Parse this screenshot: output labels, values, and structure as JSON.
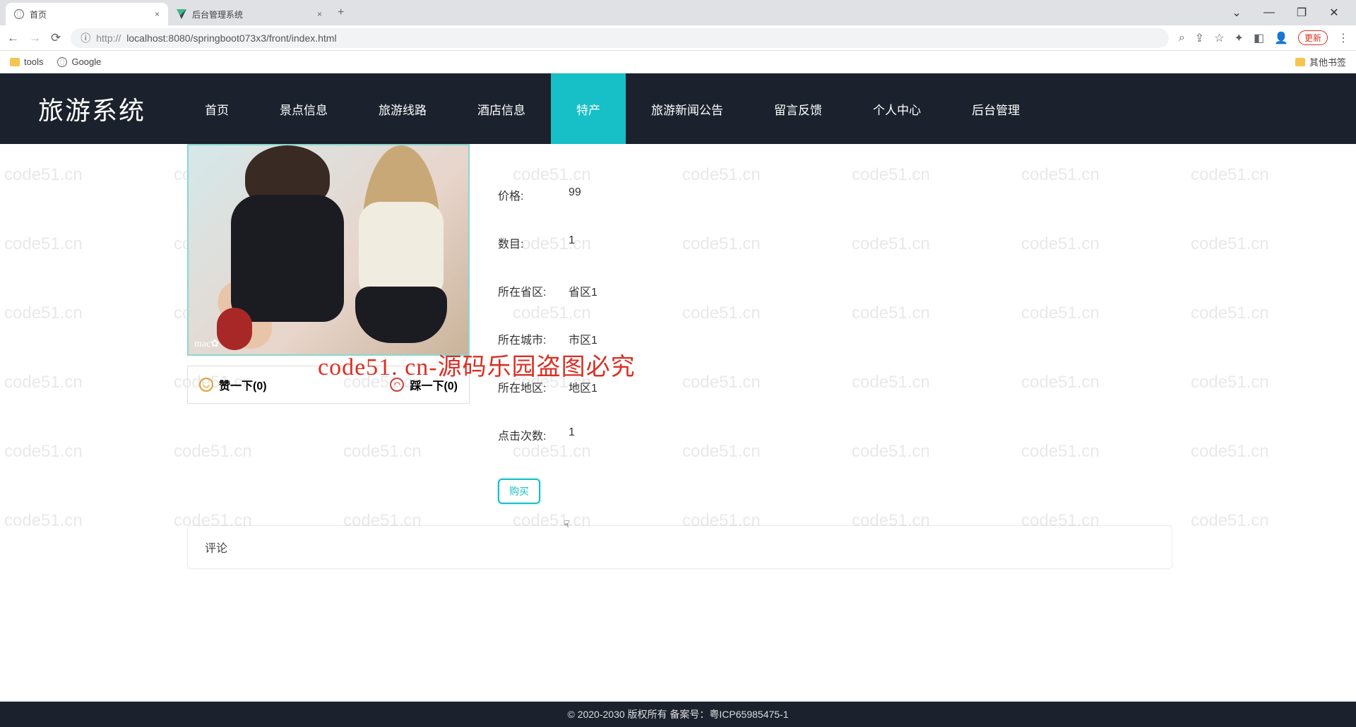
{
  "browser": {
    "tabs": [
      {
        "title": "首页",
        "icon": "globe"
      },
      {
        "title": "后台管理系统",
        "icon": "vue"
      }
    ],
    "url_scheme": "http://",
    "url_rest": "localhost:8080/springboot073x3/front/index.html",
    "update_label": "更新",
    "bookmarks": {
      "tools": "tools",
      "google": "Google",
      "other": "其他书签"
    }
  },
  "site": {
    "logo": "旅游系统",
    "nav": [
      "首页",
      "景点信息",
      "旅游线路",
      "酒店信息",
      "特产",
      "旅游新闻公告",
      "留言反馈",
      "个人中心",
      "后台管理"
    ],
    "active_index": 4
  },
  "product": {
    "image_tag": "mac✿",
    "like_label": "赞一下(0)",
    "dislike_label": "踩一下(0)",
    "rows": [
      {
        "label": "价格:",
        "value": "99"
      },
      {
        "label": "数目:",
        "value": "1"
      },
      {
        "label": "所在省区:",
        "value": "省区1"
      },
      {
        "label": "所在城市:",
        "value": "市区1"
      },
      {
        "label": "所在地区:",
        "value": "地区1"
      },
      {
        "label": "点击次数:",
        "value": "1"
      }
    ],
    "buy_label": "购买",
    "comment_header": "评论"
  },
  "overlay_watermark": "code51. cn-源码乐园盗图必究",
  "bg_watermark": "code51.cn",
  "footer": "© 2020-2030 版权所有 备案号：粤ICP65985475-1"
}
